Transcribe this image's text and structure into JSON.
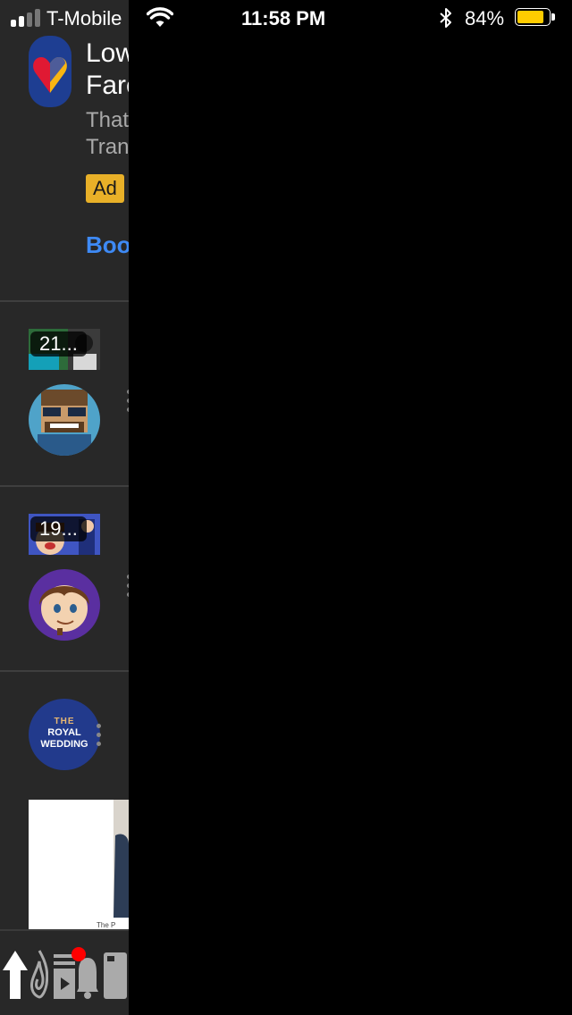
{
  "status_bar": {
    "carrier": "T-Mobile",
    "time": "11:58 PM",
    "battery_percent": "84%",
    "battery_level": 0.84,
    "signal_bars": 2,
    "icons": [
      "signal-icon",
      "wifi-icon",
      "bluetooth-icon",
      "battery-icon"
    ]
  },
  "ad": {
    "title_line1": "Low",
    "title_line2": "Fare",
    "desc_line1": "That",
    "desc_line2": "Tran",
    "badge": "Ad",
    "cta": "Boo",
    "colors": {
      "badge": "#e8b028",
      "cta": "#3e8af5",
      "icon_bg": "#1e3e92"
    }
  },
  "videos": [
    {
      "duration": "21..."
    },
    {
      "duration": "19..."
    }
  ],
  "channel_post": {
    "avatar_line1": "THE",
    "avatar_line2": "ROYAL",
    "avatar_line3": "WEDDING",
    "thumb_caption": "The P"
  },
  "bottom_nav": {
    "items": [
      "home-icon",
      "trending-icon",
      "subscriptions-icon",
      "notifications-icon",
      "library-icon"
    ],
    "notification_dot_color": "#ff0000"
  },
  "colors": {
    "background": "#282828",
    "overlay": "#000000",
    "divider": "#3f3f3f",
    "battery_fill": "#ffcc00"
  }
}
